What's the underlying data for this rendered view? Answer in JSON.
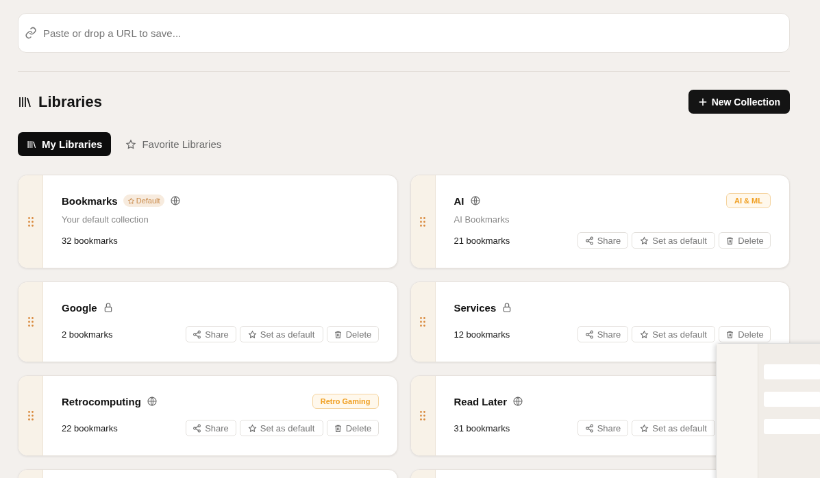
{
  "search": {
    "placeholder": "Paste or drop a URL to save..."
  },
  "header": {
    "title": "Libraries",
    "new_button": "New Collection"
  },
  "tabs": [
    {
      "label": "My Libraries",
      "selected": true
    },
    {
      "label": "Favorite Libraries",
      "selected": false
    }
  ],
  "collections": [
    {
      "name": "Bookmarks",
      "default_badge": "Default",
      "public": true,
      "description": "Your default collection",
      "count": "32 bookmarks"
    },
    {
      "name": "AI",
      "public": true,
      "tag": "AI & ML",
      "description": "AI Bookmarks",
      "count": "21 bookmarks",
      "actions": [
        {
          "kind": "share",
          "label": "Share"
        },
        {
          "kind": "default",
          "label": "Set as default"
        },
        {
          "kind": "delete",
          "label": "Delete"
        }
      ]
    },
    {
      "name": "Google",
      "public": false,
      "count": "2 bookmarks",
      "actions": [
        {
          "kind": "share",
          "label": "Share"
        },
        {
          "kind": "default",
          "label": "Set as default"
        },
        {
          "kind": "delete",
          "label": "Delete"
        }
      ]
    },
    {
      "name": "Services",
      "public": false,
      "count": "12 bookmarks",
      "actions": [
        {
          "kind": "share",
          "label": "Share"
        },
        {
          "kind": "default",
          "label": "Set as default"
        },
        {
          "kind": "delete",
          "label": "Delete"
        }
      ]
    },
    {
      "name": "Retrocomputing",
      "public": true,
      "tag": "Retro Gaming",
      "count": "22 bookmarks",
      "actions": [
        {
          "kind": "share",
          "label": "Share"
        },
        {
          "kind": "default",
          "label": "Set as default"
        },
        {
          "kind": "delete",
          "label": "Delete"
        }
      ]
    },
    {
      "name": "Read Later",
      "public": true,
      "count": "31 bookmarks",
      "actions": [
        {
          "kind": "share",
          "label": "Share"
        },
        {
          "kind": "default",
          "label": "Set as default"
        }
      ]
    }
  ]
}
